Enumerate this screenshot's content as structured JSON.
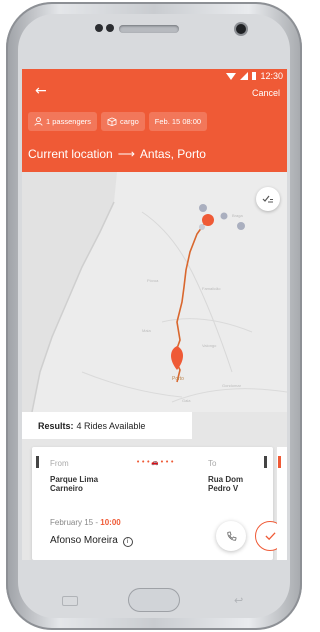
{
  "status": {
    "time": "12:30"
  },
  "header": {
    "back_icon": "arrow-left-icon",
    "cancel_label": "Cancel",
    "chips": [
      {
        "icon": "person-icon",
        "label": "1 passengers"
      },
      {
        "icon": "box-icon",
        "label": "cargo"
      },
      {
        "icon": "",
        "label": "Feb. 15 08:00"
      }
    ],
    "route": {
      "from": "Current location",
      "arrow": "⟶",
      "to": "Antas, Porto"
    }
  },
  "map": {
    "route_color": "#d9672e",
    "pin_color": "#ef5a36",
    "pin_label": "Porto",
    "filter_icon": "check-list-icon"
  },
  "results": {
    "prefix": "Results:",
    "summary": "4 Rides Available"
  },
  "ride_card": {
    "from_label": "From",
    "from_place": [
      "Parque Lima",
      "Carneiro"
    ],
    "to_label": "To",
    "to_place": [
      "Rua Dom",
      "Pedro V"
    ],
    "date": "February 15",
    "separator": "-",
    "time": "10:00",
    "driver": "Afonso Moreira",
    "info_icon": "info-icon",
    "call_icon": "phone-icon",
    "accept_icon": "check-icon"
  },
  "colors": {
    "accent": "#ef5a36"
  }
}
